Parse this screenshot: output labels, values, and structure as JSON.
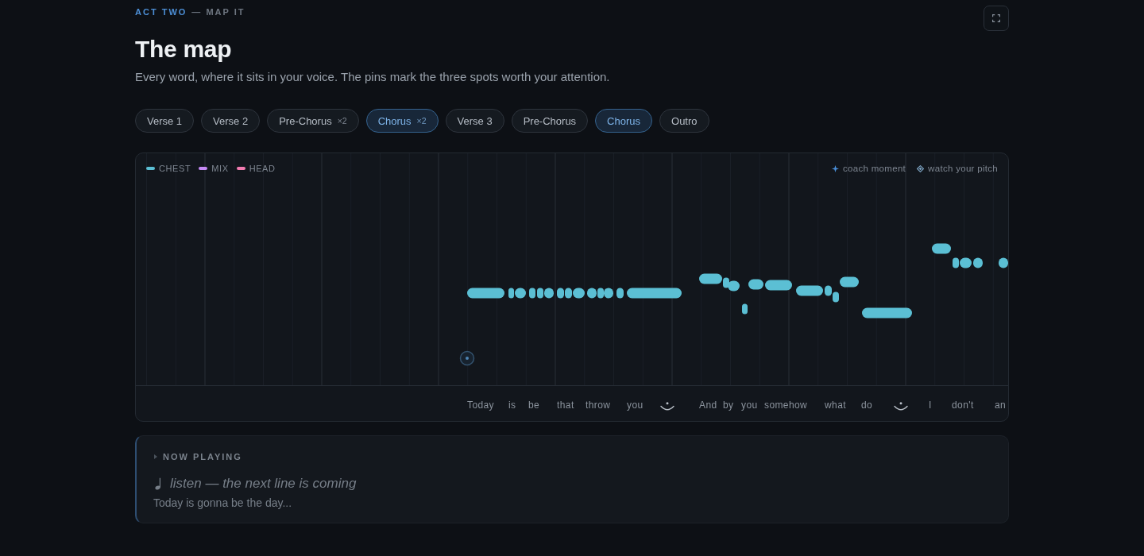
{
  "header": {
    "act": "ACT TWO",
    "step": "— MAP IT",
    "title": "The map",
    "subtitle": "Every word, where it sits in your voice. The pins mark the three spots worth your attention."
  },
  "tabs": [
    {
      "label": "Verse 1",
      "selected": false
    },
    {
      "label": "Verse 2",
      "selected": false
    },
    {
      "label": "Pre-Chorus",
      "count": "×2",
      "selected": false
    },
    {
      "label": "Chorus",
      "count": "×2",
      "selected": true
    },
    {
      "label": "Verse 3",
      "selected": false
    },
    {
      "label": "Pre-Chorus",
      "selected": false
    },
    {
      "label": "Chorus",
      "selected": true
    },
    {
      "label": "Outro",
      "selected": false
    }
  ],
  "map": {
    "legend": [
      {
        "label": "CHEST",
        "color": "#5bbfd4"
      },
      {
        "label": "MIX",
        "color": "#c58af5"
      },
      {
        "label": "HEAD",
        "color": "#f27bb0"
      }
    ],
    "markers": [
      {
        "kind": "coach",
        "label": "coach moment"
      },
      {
        "kind": "pitch",
        "label": "watch your pitch"
      }
    ],
    "lyrics": [
      {
        "kind": "word",
        "text": "Today"
      },
      {
        "kind": "word",
        "text": "is"
      },
      {
        "kind": "word",
        "text": "be"
      },
      {
        "kind": "word",
        "text": "that"
      },
      {
        "kind": "word",
        "text": "throw"
      },
      {
        "kind": "word",
        "text": "you"
      },
      {
        "kind": "breath"
      },
      {
        "kind": "word",
        "text": "And"
      },
      {
        "kind": "word",
        "text": "by"
      },
      {
        "kind": "word",
        "text": "you"
      },
      {
        "kind": "word",
        "text": "somehow"
      },
      {
        "kind": "word",
        "text": "what"
      },
      {
        "kind": "word",
        "text": "do"
      },
      {
        "kind": "breath"
      },
      {
        "kind": "word",
        "text": "I"
      },
      {
        "kind": "word",
        "text": "don't"
      },
      {
        "kind": "word",
        "text": "an"
      }
    ]
  },
  "now_playing": {
    "label": "NOW PLAYING",
    "cue": "listen — the next line is coming",
    "line": "Today is gonna be the day..."
  }
}
